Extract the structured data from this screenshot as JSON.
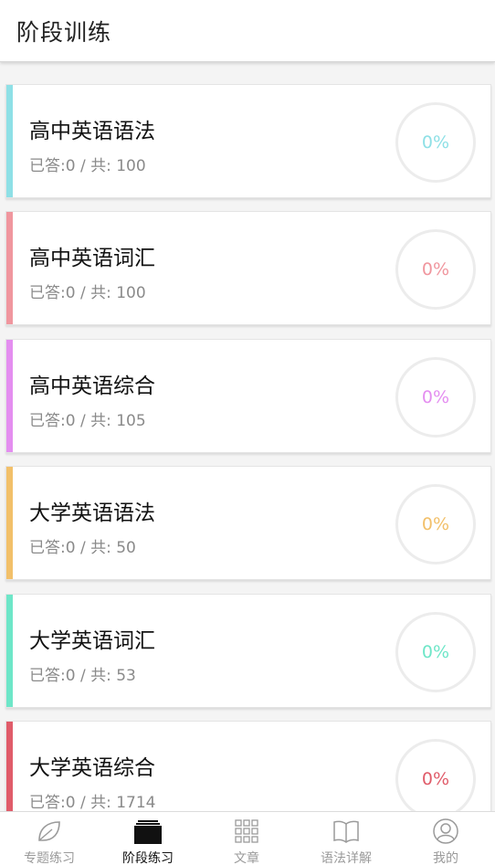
{
  "header": {
    "title": "阶段训练"
  },
  "cards": [
    {
      "title": "高中英语语法",
      "stats": "已答:0 / 共: 100",
      "progress_text": "0%",
      "progress": 0,
      "color": "#8ee0e6"
    },
    {
      "title": "高中英语词汇",
      "stats": "已答:0 / 共: 100",
      "progress_text": "0%",
      "progress": 0,
      "color": "#f0969e"
    },
    {
      "title": "高中英语综合",
      "stats": "已答:0 / 共: 105",
      "progress_text": "0%",
      "progress": 0,
      "color": "#e48ef0"
    },
    {
      "title": "大学英语语法",
      "stats": "已答:0 / 共: 50",
      "progress_text": "0%",
      "progress": 0,
      "color": "#f2c06a"
    },
    {
      "title": "大学英语词汇",
      "stats": "已答:0 / 共: 53",
      "progress_text": "0%",
      "progress": 0,
      "color": "#6ee6c8"
    },
    {
      "title": "大学英语综合",
      "stats": "已答:0 / 共: 1714",
      "progress_text": "0%",
      "progress": 0,
      "color": "#e05c6a"
    }
  ],
  "tabbar": {
    "tabs": [
      {
        "label": "专题练习",
        "icon": "leaf-icon",
        "active": false
      },
      {
        "label": "阶段练习",
        "icon": "stack-icon",
        "active": true
      },
      {
        "label": "文章",
        "icon": "grid-icon",
        "active": false
      },
      {
        "label": "语法详解",
        "icon": "book-icon",
        "active": false
      },
      {
        "label": "我的",
        "icon": "user-icon",
        "active": false
      }
    ]
  },
  "colors": {
    "tab_active": "#111111",
    "tab_inactive": "#9a9a9a"
  }
}
